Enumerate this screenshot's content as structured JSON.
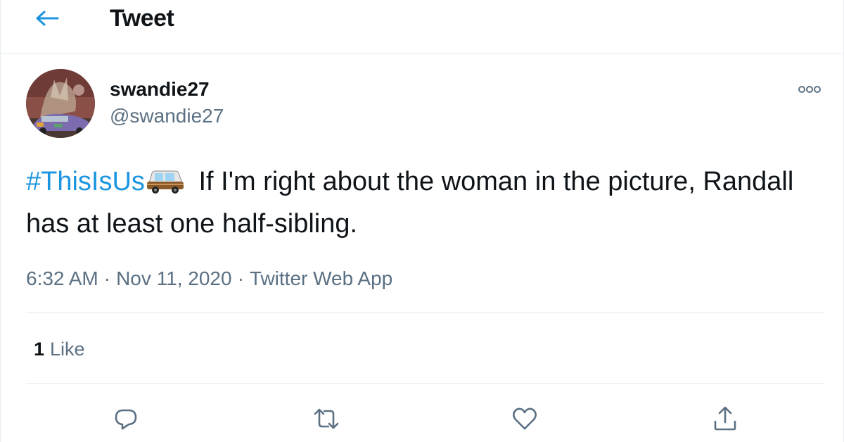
{
  "header": {
    "title": "Tweet",
    "back_icon": "back-arrow-icon"
  },
  "tweet": {
    "author": {
      "display_name": "swandie27",
      "handle": "@swandie27"
    },
    "hashtag": "#ThisIsUs",
    "emoji": "car-emoji",
    "body": " If I'm right about the woman in the picture, Randall has at least one half-sibling.",
    "time": "6:32 AM",
    "date": "Nov 11, 2020",
    "source": "Twitter Web App",
    "separator": "·",
    "stats": {
      "likes_count": "1",
      "likes_label": "Like"
    }
  },
  "actions": {
    "icons": [
      "reply-icon",
      "retweet-icon",
      "like-icon",
      "share-icon"
    ]
  },
  "colors": {
    "accent": "#1b95e0",
    "text_primary": "#0f1419",
    "text_secondary": "#5b7083",
    "border": "#e6ecf0"
  }
}
